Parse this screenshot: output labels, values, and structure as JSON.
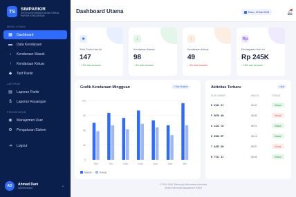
{
  "brand": {
    "logo": "TS",
    "name": "SIMPARKIR",
    "subtitle": "SISTEM INFORMASI MONITORING PARKIR KENDARAAN"
  },
  "sidebar": {
    "sections": [
      {
        "label": "MENU UTAMA",
        "items": [
          {
            "label": "Dashboard",
            "icon": "grid-icon",
            "active": true
          },
          {
            "label": "Data Kendaraan",
            "icon": "car-icon"
          },
          {
            "label": "Kendaraan Masuk",
            "icon": "arrow-down-icon"
          },
          {
            "label": "Kendaraan Keluar",
            "icon": "arrow-up-icon"
          },
          {
            "label": "Tarif Parkir",
            "icon": "tag-icon"
          }
        ]
      },
      {
        "label": "LAPORAN",
        "items": [
          {
            "label": "Laporan Parkir",
            "icon": "file-icon"
          },
          {
            "label": "Laporan Keuangan",
            "icon": "dollar-icon"
          }
        ]
      },
      {
        "label": "PENGATURAN",
        "items": [
          {
            "label": "Manajemen User",
            "icon": "users-icon"
          },
          {
            "label": "Pengaturan Sistem",
            "icon": "gear-icon"
          }
        ]
      },
      {
        "label": "",
        "items": [
          {
            "label": "Logout",
            "icon": "logout-icon"
          }
        ]
      }
    ],
    "user": {
      "initials": "AD",
      "name": "Ahmad Dani",
      "role": "Administrator"
    }
  },
  "header": {
    "title": "Dashboard Utama",
    "date": "Rabu, 15 Mei 2024"
  },
  "stats": [
    {
      "label": "Total Parkir Hari Ini",
      "value": "147",
      "change": "↑ 12% dari kemarin",
      "icon": "car-icon",
      "glyph": "■",
      "accent": "#2f6bff",
      "tint": "#e8efff",
      "change_color": "#2e9d4e"
    },
    {
      "label": "Kendaraan Masuk",
      "value": "98",
      "change": "↑ 8% dari kemarin",
      "icon": "arrow-down-icon",
      "glyph": "↓",
      "accent": "#2e9d4e",
      "tint": "#e3f6e8",
      "change_color": "#2e9d4e"
    },
    {
      "label": "Kendaraan Keluar",
      "value": "49",
      "change": "↓ 3% dari kemarin",
      "icon": "arrow-up-icon",
      "glyph": "↑",
      "accent": "#f2772e",
      "tint": "#fdeee3",
      "change_color": "#e53935"
    },
    {
      "label": "Pendapatan Hari Ini",
      "value": "Rp 245K",
      "change": "↑ 15% dari kemarin",
      "icon": "rupiah-icon",
      "glyph": "Rp",
      "accent": "#8a5cf6",
      "tint": "#f0eafe",
      "change_color": "#2e9d4e"
    }
  ],
  "chart": {
    "title": "Grafik Kendaraan Mingguan",
    "range_label": "7 Hari Terakhir",
    "legend": [
      {
        "name": "Masuk",
        "color": "#2f6bff"
      },
      {
        "name": "Keluar",
        "color": "#9db8f5"
      }
    ]
  },
  "chart_data": {
    "type": "bar",
    "categories": [
      "Sen",
      "Sel",
      "Rab",
      "Kam",
      "Jum",
      "Sab",
      "Min"
    ],
    "series": [
      {
        "name": "Masuk",
        "values": [
          75,
          95,
          85,
          100,
          80,
          70,
          115
        ]
      },
      {
        "name": "Keluar",
        "values": [
          58,
          70,
          62,
          73,
          66,
          50,
          70
        ]
      }
    ],
    "yticks": [
      0,
      30,
      60,
      90,
      120
    ],
    "ylim": [
      0,
      120
    ],
    "grid": true,
    "legend_position": "bottom-left"
  },
  "activity": {
    "title": "Aktivitas Terbaru",
    "action_label": "Lihat",
    "columns": [
      "PLAT NOMOR",
      "WAKTU",
      "STATUS"
    ],
    "rows": [
      {
        "plate": "B 2341 XY",
        "time": "08:42",
        "status": "Masuk",
        "type": "in"
      },
      {
        "plate": "F 5678 AB",
        "time": "08:35",
        "status": "Keluar",
        "type": "out"
      },
      {
        "plate": "A 1122 CD",
        "time": "08:21",
        "status": "Masuk",
        "type": "in"
      },
      {
        "plate": "B 9988 EF",
        "time": "08:15",
        "status": "Masuk",
        "type": "in"
      },
      {
        "plate": "T 4455 GH",
        "time": "08:07",
        "status": "Keluar",
        "type": "out"
      },
      {
        "plate": "B 7721 IJ",
        "time": "08:05",
        "status": "Masuk",
        "type": "in"
      }
    ]
  },
  "footer": {
    "line1": "© 2024 SMK Teknologi Informatika Indonesia",
    "line2": "Sistem Informasi Manajemen Parkir"
  }
}
